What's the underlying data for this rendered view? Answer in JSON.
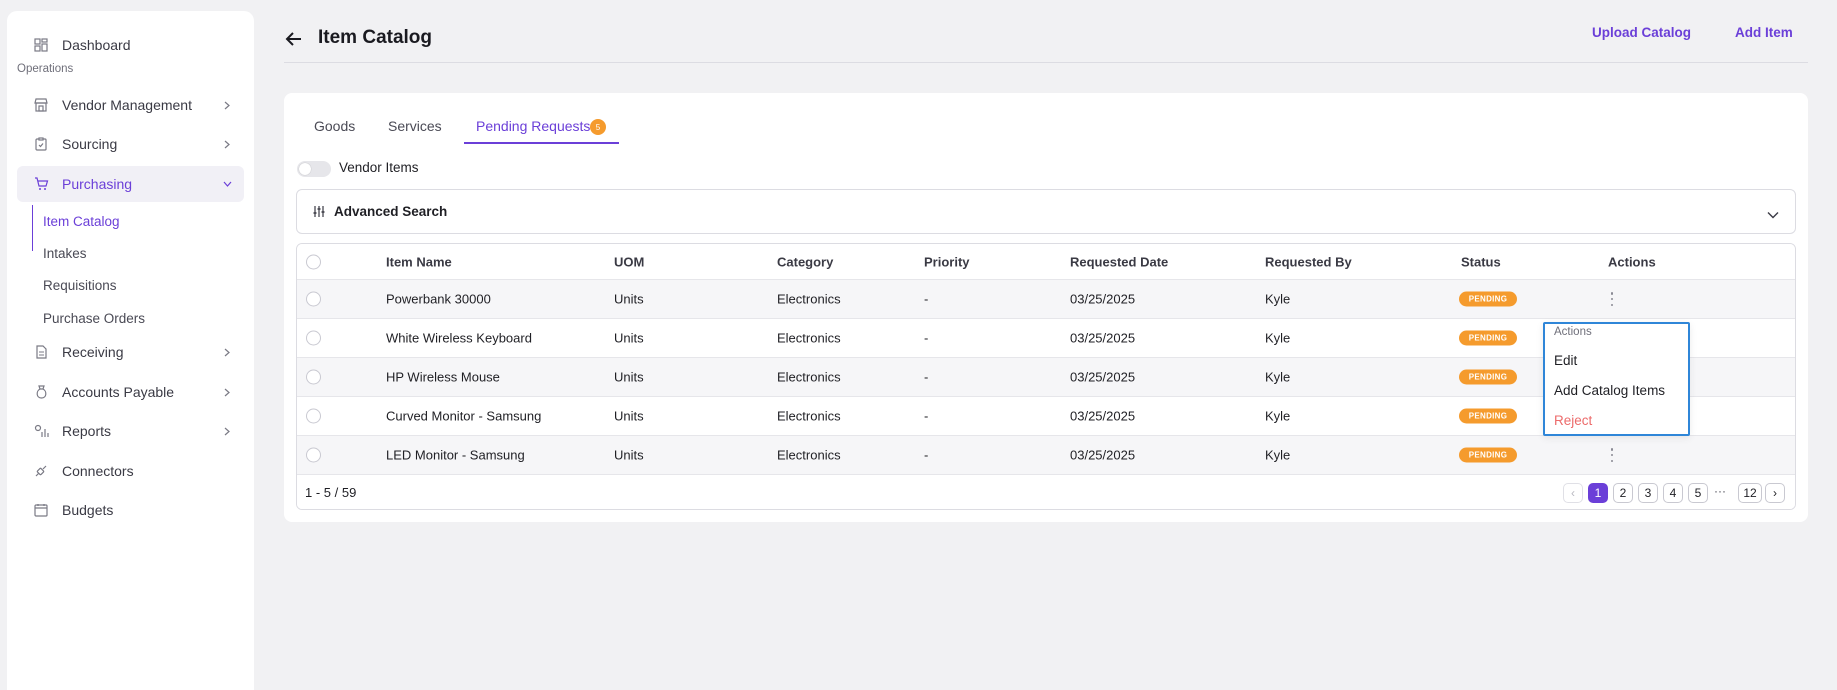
{
  "sidebar": {
    "dashboard": "Dashboard",
    "section_operations": "Operations",
    "vendor_management": "Vendor Management",
    "sourcing": "Sourcing",
    "purchasing": "Purchasing",
    "purchasing_sub": [
      "Item Catalog",
      "Intakes",
      "Requisitions",
      "Purchase Orders"
    ],
    "receiving": "Receiving",
    "accounts_payable": "Accounts Payable",
    "reports": "Reports",
    "connectors": "Connectors",
    "budgets": "Budgets"
  },
  "header": {
    "title": "Item Catalog",
    "upload_catalog": "Upload Catalog",
    "add_item": "Add Item"
  },
  "tabs": {
    "goods": "Goods",
    "services": "Services",
    "pending_requests": "Pending Requests",
    "pending_count": "5"
  },
  "toggle": {
    "label": "Vendor Items",
    "on": false
  },
  "advanced_search": {
    "label": "Advanced Search"
  },
  "table": {
    "columns": [
      "Item Name",
      "UOM",
      "Category",
      "Priority",
      "Requested Date",
      "Requested By",
      "Status",
      "Actions"
    ],
    "rows": [
      [
        "Powerbank 30000",
        "Units",
        "Electronics",
        "-",
        "03/25/2025",
        "Kyle",
        "PENDING"
      ],
      [
        "White Wireless Keyboard",
        "Units",
        "Electronics",
        "-",
        "03/25/2025",
        "Kyle",
        "PENDING"
      ],
      [
        "HP Wireless Mouse",
        "Units",
        "Electronics",
        "-",
        "03/25/2025",
        "Kyle",
        "PENDING"
      ],
      [
        "Curved Monitor - Samsung",
        "Units",
        "Electronics",
        "-",
        "03/25/2025",
        "Kyle",
        "PENDING"
      ],
      [
        "LED Monitor - Samsung",
        "Units",
        "Electronics",
        "-",
        "03/25/2025",
        "Kyle",
        "PENDING"
      ]
    ]
  },
  "pagination": {
    "range": "1 - 5 / 59",
    "prev": "‹",
    "pages": [
      "1",
      "2",
      "3",
      "4",
      "5"
    ],
    "ellipsis": "···",
    "last": "12",
    "next": "›",
    "current": "1"
  },
  "actions_menu": {
    "heading": "Actions",
    "edit": "Edit",
    "add_catalog_items": "Add Catalog Items",
    "reject": "Reject"
  },
  "colors": {
    "accent": "#6b3fd8",
    "pending": "#f59b2d",
    "danger": "#ec6b6b",
    "focus": "#2f86d8"
  }
}
